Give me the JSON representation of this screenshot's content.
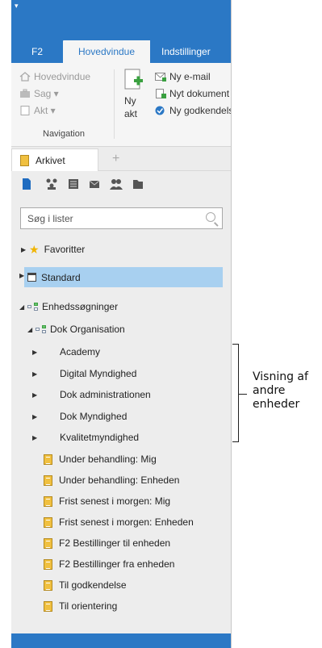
{
  "quick_access": "▾",
  "ribbon_tabs": [
    {
      "label": "F2"
    },
    {
      "label": "Hovedvindue"
    },
    {
      "label": "Indstillinger"
    }
  ],
  "ribbon": {
    "nav_items": [
      "Hovedvindue",
      "Sag ▾",
      "Akt ▾"
    ],
    "group_label": "Navigation",
    "new_act_label_line1": "Ny",
    "new_act_label_line2": "akt",
    "new_items": [
      "Ny e-mail",
      "Nyt dokument",
      "Ny godkendelse"
    ]
  },
  "doc_tab": {
    "label": "Arkivet",
    "add": "+"
  },
  "search": {
    "placeholder": "Søg i lister"
  },
  "tree": {
    "favorites": "Favoritter",
    "standard": "Standard",
    "unit_searches": "Enhedssøgninger",
    "dok_org": "Dok Organisation",
    "units": [
      "Academy",
      "Digital Myndighed",
      "Dok administrationen",
      "Dok Myndighed",
      "Kvalitetmyndighed"
    ],
    "lists": [
      "Under behandling: Mig",
      "Under behandling: Enheden",
      "Frist senest i morgen: Mig",
      "Frist senest i morgen: Enheden",
      "F2 Bestillinger til enheden",
      "F2 Bestillinger fra enheden",
      "Til godkendelse",
      "Til orientering"
    ]
  },
  "annotation": {
    "line1": "Visning af",
    "line2": "andre",
    "line3": "enheder"
  },
  "colors": {
    "accent": "#2b78c5",
    "selected": "#a8d0f0",
    "list_icon": "#f0c040"
  }
}
